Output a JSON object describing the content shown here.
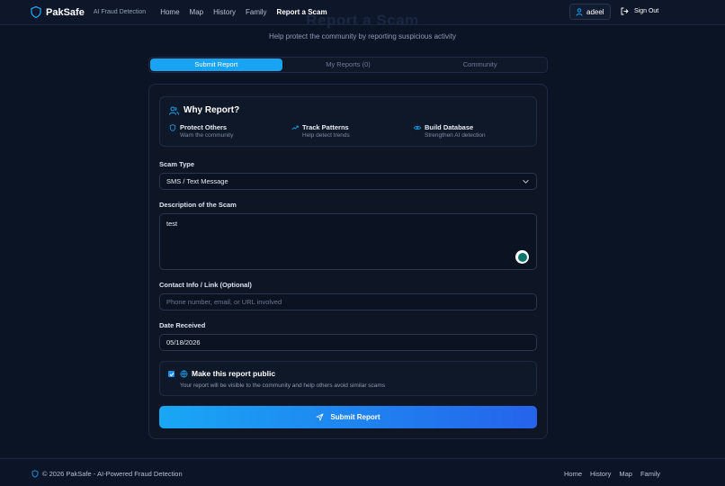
{
  "header": {
    "brand_name": "PakSafe",
    "brand_tagline": "AI Fraud Detection",
    "nav": [
      "Home",
      "Map",
      "History",
      "Family",
      "Report a Scam"
    ],
    "active_nav": "Report a Scam",
    "username": "adeel",
    "sign_out": "Sign Out"
  },
  "page": {
    "title": "Report a Scam",
    "subtitle": "Help protect the community by reporting suspicious activity"
  },
  "tabs": [
    "Submit Report",
    "My Reports (0)",
    "Community"
  ],
  "why": {
    "title": "Why Report?",
    "benefits": [
      {
        "title": "Protect Others",
        "subtitle": "Warn the community"
      },
      {
        "title": "Track Patterns",
        "subtitle": "Help detect trends"
      },
      {
        "title": "Build Database",
        "subtitle": "Strengthen AI detection"
      }
    ]
  },
  "form": {
    "scam_type_label": "Scam Type",
    "scam_type_value": "SMS / Text Message",
    "description_label": "Description of the Scam",
    "description_value": "test",
    "contact_label": "Contact Info / Link (Optional)",
    "contact_placeholder": "Phone number, email, or URL involved",
    "date_label": "Date Received",
    "date_value": "05/18/2026",
    "public_label": "Make this report public",
    "public_checked": true,
    "public_note": "Your report will be visible to the community and help others avoid similar scams",
    "submit_label": "Submit Report"
  },
  "footer": {
    "copyright": "© 2026 PakSafe - AI-Powered Fraud Detection",
    "links": [
      "Home",
      "History",
      "Map",
      "Family"
    ]
  },
  "colors": {
    "accent": "#18a4f3",
    "background": "#0b1424"
  }
}
